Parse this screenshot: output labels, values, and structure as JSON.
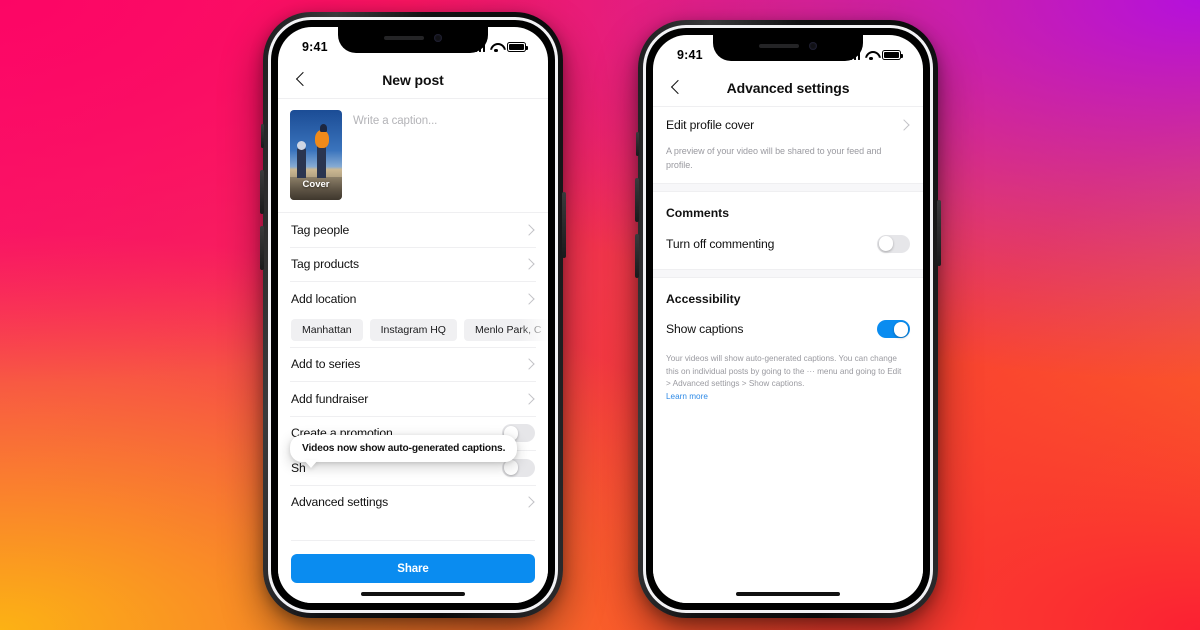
{
  "background": {
    "gradient_colors": [
      "#fc0565",
      "#b510dc",
      "#fb2033",
      "#fcb214"
    ]
  },
  "accent_color": "#0a8cf0",
  "phones": [
    {
      "id": "left",
      "status_bar": {
        "time": "9:41",
        "signal_icon": "cellular-signal-icon",
        "wifi_icon": "wifi-icon",
        "battery_icon": "battery-icon"
      },
      "nav": {
        "back_icon": "chevron-left-icon",
        "title": "New post"
      },
      "composer": {
        "thumbnail_label": "Cover",
        "caption_placeholder": "Write a caption..."
      },
      "rows": [
        {
          "label": "Tag people",
          "type": "chevron"
        },
        {
          "label": "Tag products",
          "type": "chevron"
        },
        {
          "label": "Add location",
          "type": "chevron"
        },
        {
          "label": "Add to series",
          "type": "chevron"
        },
        {
          "label": "Add fundraiser",
          "type": "chevron"
        },
        {
          "label": "Create a promotion",
          "type": "toggle",
          "on": false
        },
        {
          "label": "Sh",
          "type": "toggle",
          "on": false
        },
        {
          "label": "Advanced settings",
          "type": "chevron"
        }
      ],
      "location_chips": [
        "Manhattan",
        "Instagram HQ",
        "Menlo Park, C"
      ],
      "tooltip": {
        "text": "Videos now show auto-generated captions."
      },
      "share_button": "Share"
    },
    {
      "id": "right",
      "status_bar": {
        "time": "9:41",
        "signal_icon": "cellular-signal-icon",
        "wifi_icon": "wifi-icon",
        "battery_icon": "battery-icon"
      },
      "nav": {
        "back_icon": "chevron-left-icon",
        "title": "Advanced settings"
      },
      "edit_profile_cover": {
        "label": "Edit profile cover",
        "helper": "A preview of your video will be shared to your feed and profile."
      },
      "comments": {
        "heading": "Comments",
        "row_label": "Turn off commenting",
        "toggle_on": false
      },
      "accessibility": {
        "heading": "Accessibility",
        "row_label": "Show captions",
        "toggle_on": true,
        "helper": "Your videos will show auto-generated captions. You can change this on individual posts by going to the  ···  menu and going to Edit > Advanced settings > Show captions.",
        "link_label": "Learn more"
      }
    }
  ]
}
